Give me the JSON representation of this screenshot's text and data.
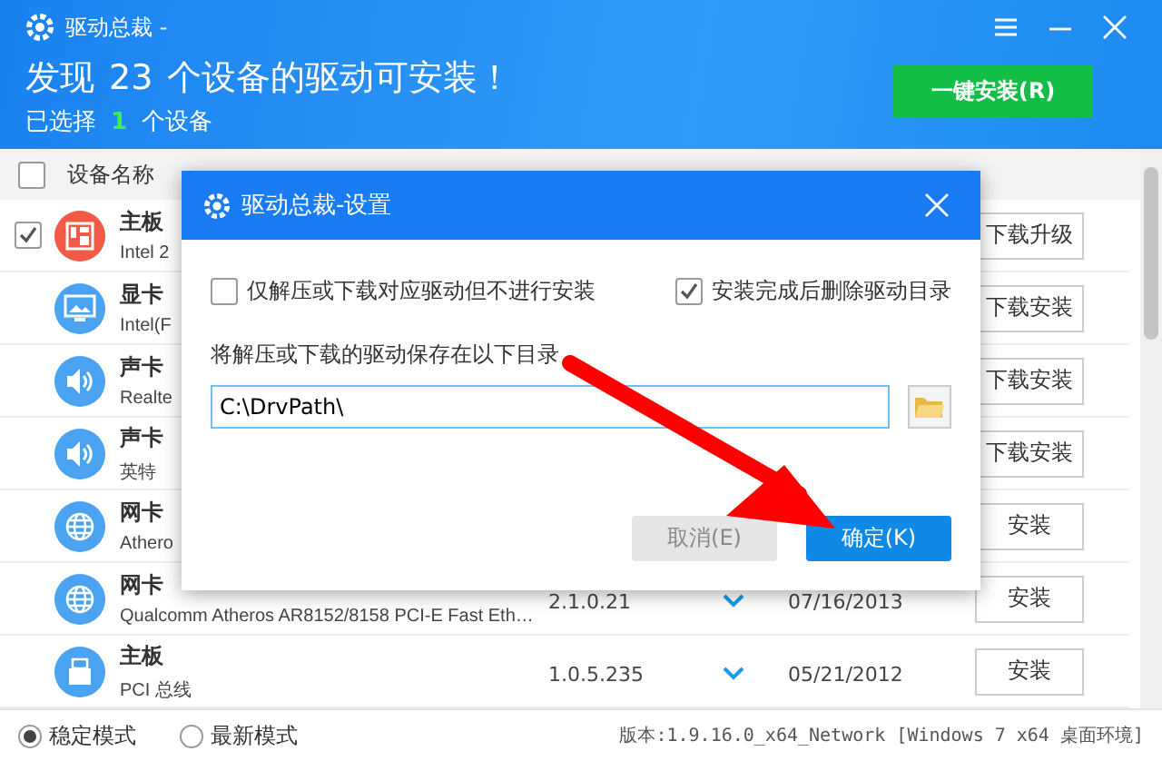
{
  "window": {
    "title": "驱动总裁 -"
  },
  "banner": {
    "headline_prefix": "发现",
    "count": "23",
    "headline_suffix": "个设备的驱动可安装！",
    "selected_prefix": "已选择",
    "selected_count": "1",
    "selected_suffix": "个设备",
    "install_button": "一键安装(R)"
  },
  "table": {
    "header_checked": false,
    "columns": [
      "设备名称"
    ],
    "rows": [
      {
        "kind": "board",
        "color": "#f25a45",
        "checked": true,
        "name": "主板",
        "detail": "Intel 2",
        "action": "下载升级"
      },
      {
        "kind": "display",
        "color": "#4aa3f0",
        "name": "显卡",
        "detail": "Intel(F",
        "action": "下载安装"
      },
      {
        "kind": "speaker",
        "color": "#4aa3f0",
        "name": "声卡",
        "detail": "Realte",
        "action": "下载安装"
      },
      {
        "kind": "speaker",
        "color": "#4aa3f0",
        "name": "声卡",
        "detail": "英特",
        "action": "下载安装"
      },
      {
        "kind": "globe",
        "color": "#4aa3f0",
        "name": "网卡",
        "detail": "Athero",
        "action": "安装"
      },
      {
        "kind": "globe",
        "color": "#4aa3f0",
        "name": "网卡",
        "detail": "Qualcomm Atheros AR8152/8158 PCI-E Fast Eth…",
        "version": "2.1.0.21",
        "date": "07/16/2013",
        "action": "安装"
      },
      {
        "kind": "usb",
        "color": "#4aa3f0",
        "name": "主板",
        "detail": "PCI 总线",
        "version": "1.0.5.235",
        "date": "05/21/2012",
        "action": "安装"
      }
    ]
  },
  "modes": [
    {
      "label": "稳定模式",
      "selected": true
    },
    {
      "label": "最新模式",
      "selected": false
    }
  ],
  "version_text": "版本:1.9.16.0_x64_Network [Windows 7 x64 桌面环境]",
  "dialog": {
    "title": "驱动总裁-设置",
    "options": [
      {
        "label": "仅解压或下载对应驱动但不进行安装",
        "checked": false
      },
      {
        "label": "安装完成后删除驱动目录",
        "checked": true
      }
    ],
    "path_label": "将解压或下载的驱动保存在以下目录",
    "path_value": "C:\\DrvPath\\",
    "cancel": "取消(E)",
    "ok": "确定(K)"
  }
}
